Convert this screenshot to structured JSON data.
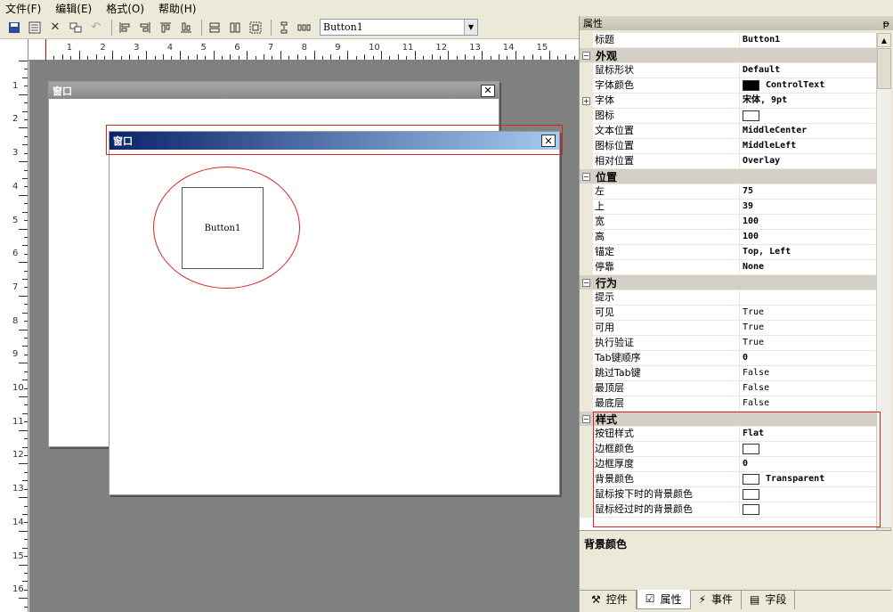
{
  "menu": [
    "文件(F)",
    "编辑(E)",
    "格式(O)",
    "帮助(H)"
  ],
  "toolbar": {
    "object_select": "Button1"
  },
  "ruler": {
    "h_labels": [
      "1",
      "2",
      "3",
      "4",
      "5",
      "6",
      "7",
      "8",
      "9",
      "10",
      "11",
      "12",
      "13",
      "14",
      "15"
    ],
    "v_labels": [
      "1",
      "2",
      "3",
      "4",
      "5",
      "6",
      "7",
      "8",
      "9",
      "10",
      "11",
      "12",
      "13",
      "14",
      "15",
      "16"
    ]
  },
  "designer": {
    "window1_title": "窗口",
    "window2_title": "窗口",
    "button_label": "Button1",
    "close_glyph": "✕"
  },
  "panel": {
    "title": "属性",
    "pin": "ᵽ",
    "rows": [
      {
        "name": "标题",
        "value": "Button1"
      },
      {
        "cat": "外观"
      },
      {
        "name": "鼠标形状",
        "value": "Default"
      },
      {
        "name": "字体颜色",
        "value": "ControlText",
        "swatch": "#000000"
      },
      {
        "name": "字体",
        "value": "宋体, 9pt",
        "expander": "+"
      },
      {
        "name": "图标",
        "value": "",
        "swatch": "#ffffff"
      },
      {
        "name": "文本位置",
        "value": "MiddleCenter"
      },
      {
        "name": "图标位置",
        "value": "MiddleLeft"
      },
      {
        "name": "相对位置",
        "value": "Overlay"
      },
      {
        "cat": "位置"
      },
      {
        "name": "左",
        "value": "75"
      },
      {
        "name": "上",
        "value": "39"
      },
      {
        "name": "宽",
        "value": "100"
      },
      {
        "name": "高",
        "value": "100"
      },
      {
        "name": "锚定",
        "value": "Top, Left"
      },
      {
        "name": "停靠",
        "value": "None"
      },
      {
        "cat": "行为"
      },
      {
        "name": "提示",
        "value": ""
      },
      {
        "name": "可见",
        "value": "True",
        "normal": true
      },
      {
        "name": "可用",
        "value": "True",
        "normal": true
      },
      {
        "name": "执行验证",
        "value": "True",
        "normal": true
      },
      {
        "name": "Tab键顺序",
        "value": "0"
      },
      {
        "name": "跳过Tab键",
        "value": "False",
        "normal": true
      },
      {
        "name": "最顶层",
        "value": "False",
        "normal": true
      },
      {
        "name": "最底层",
        "value": "False",
        "normal": true
      },
      {
        "cat": "样式"
      },
      {
        "name": "按钮样式",
        "value": "Flat"
      },
      {
        "name": "边框颜色",
        "value": "",
        "swatch": "#ffffff"
      },
      {
        "name": "边框厚度",
        "value": "0"
      },
      {
        "name": "背景颜色",
        "value": "Transparent",
        "swatch": "#ffffff"
      },
      {
        "name": "鼠标按下时的背景颜色",
        "value": "",
        "swatch": "#ffffff"
      },
      {
        "name": "鼠标经过时的背景颜色",
        "value": "",
        "swatch": "#ffffff"
      }
    ],
    "description_title": "背景颜色",
    "tabs": [
      {
        "label": "控件",
        "icon": "⚒"
      },
      {
        "label": "属性",
        "icon": "☑",
        "active": true
      },
      {
        "label": "事件",
        "icon": "⚡"
      },
      {
        "label": "字段",
        "icon": "▤"
      }
    ]
  }
}
